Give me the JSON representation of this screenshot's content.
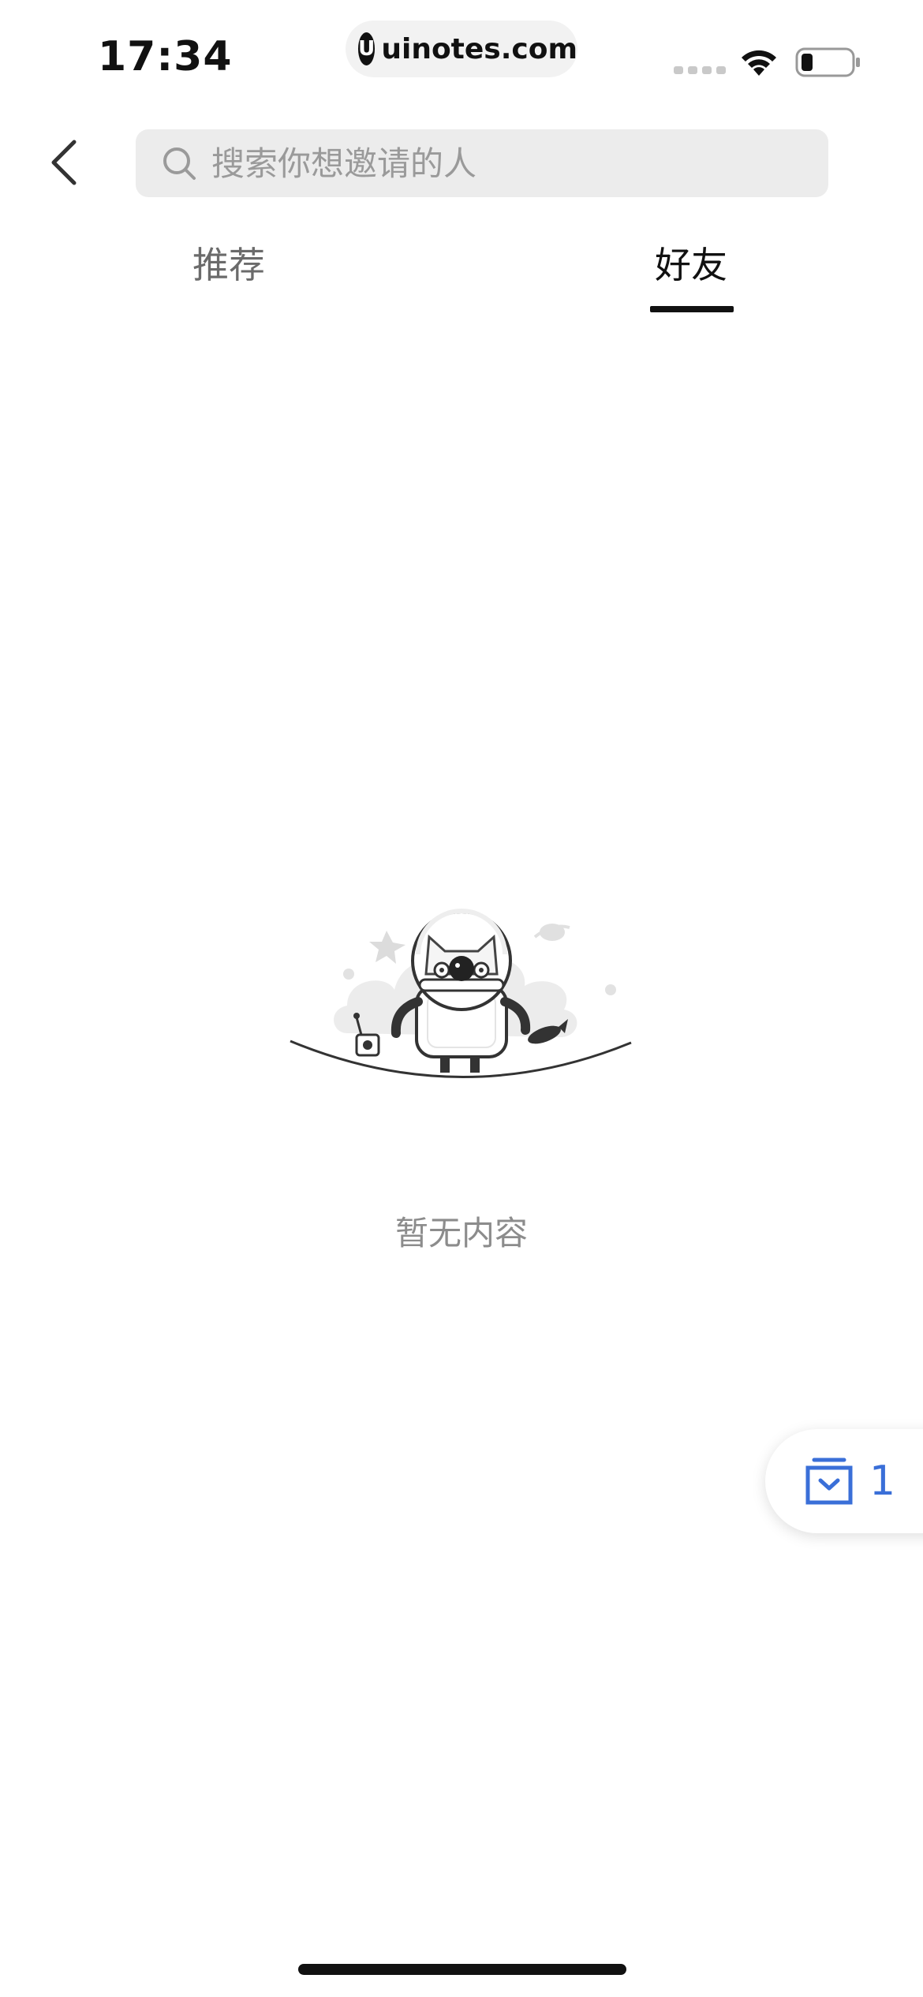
{
  "status_bar": {
    "time": "17:34",
    "url": "uinotes.com",
    "url_logo_letter": "U"
  },
  "header": {
    "back_icon": "chevron-left-icon",
    "search": {
      "placeholder": "搜索你想邀请的人",
      "value": "",
      "icon": "search-icon"
    }
  },
  "tabs": [
    {
      "label": "推荐",
      "active": false
    },
    {
      "label": "好友",
      "active": true
    }
  ],
  "empty_state": {
    "illustration": "astronaut-cat-robot-illustration",
    "text": "暂无内容"
  },
  "floating_inbox": {
    "icon": "inbox-download-icon",
    "count": "1",
    "color": "#3a6fd8"
  },
  "colors": {
    "accent": "#3a6fd8",
    "tab_active": "#111111",
    "tab_inactive": "#6b6b6b",
    "search_bg": "#ececec"
  }
}
